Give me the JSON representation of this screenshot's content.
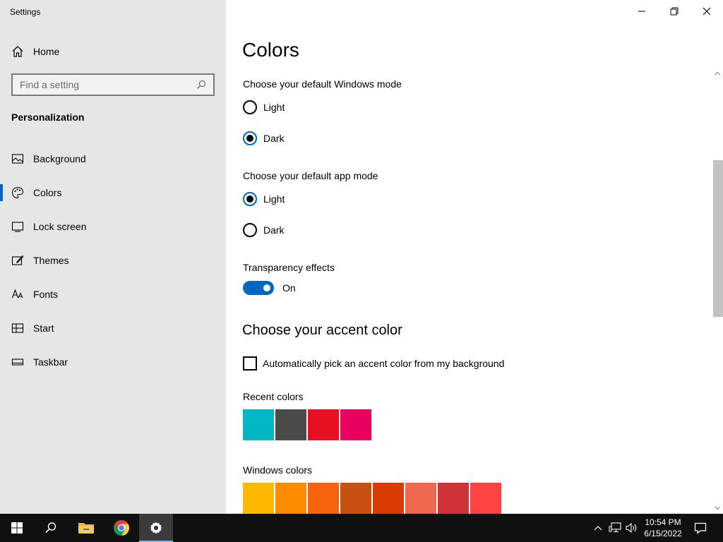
{
  "window": {
    "title": "Settings"
  },
  "sidebar": {
    "home_label": "Home",
    "search_placeholder": "Find a setting",
    "section_heading": "Personalization",
    "items": [
      {
        "label": "Background",
        "icon": "picture-icon"
      },
      {
        "label": "Colors",
        "icon": "palette-icon",
        "selected": true
      },
      {
        "label": "Lock screen",
        "icon": "lock-screen-icon"
      },
      {
        "label": "Themes",
        "icon": "brush-icon"
      },
      {
        "label": "Fonts",
        "icon": "font-icon"
      },
      {
        "label": "Start",
        "icon": "start-icon"
      },
      {
        "label": "Taskbar",
        "icon": "taskbar-icon"
      }
    ]
  },
  "main": {
    "title": "Colors",
    "windows_mode": {
      "label": "Choose your default Windows mode",
      "options": [
        "Light",
        "Dark"
      ],
      "selected": "Dark"
    },
    "app_mode": {
      "label": "Choose your default app mode",
      "options": [
        "Light",
        "Dark"
      ],
      "selected": "Light"
    },
    "transparency": {
      "label": "Transparency effects",
      "state": "On"
    },
    "accent_heading": "Choose your accent color",
    "auto_accent_label": "Automatically pick an accent color from my background",
    "auto_accent_checked": false,
    "recent_colors_label": "Recent colors",
    "recent_colors": [
      "#00b7c3",
      "#4c4a48",
      "#e81123",
      "#ea005e"
    ],
    "windows_colors_label": "Windows colors",
    "windows_colors": [
      "#ffb900",
      "#ff8c00",
      "#f7630c",
      "#ca5010",
      "#da3b01",
      "#ef6950",
      "#d13438",
      "#ff4343"
    ]
  },
  "taskbar": {
    "apps": [
      "start-icon",
      "search-icon",
      "file-explorer-icon",
      "chrome-icon",
      "settings-icon"
    ],
    "active_app": "settings-icon",
    "time": "10:54 PM",
    "date": "6/15/2022"
  },
  "colors": {
    "accent": "#0067c0",
    "sidebar_bg": "#e6e6e6",
    "taskbar_bg": "#101010"
  }
}
